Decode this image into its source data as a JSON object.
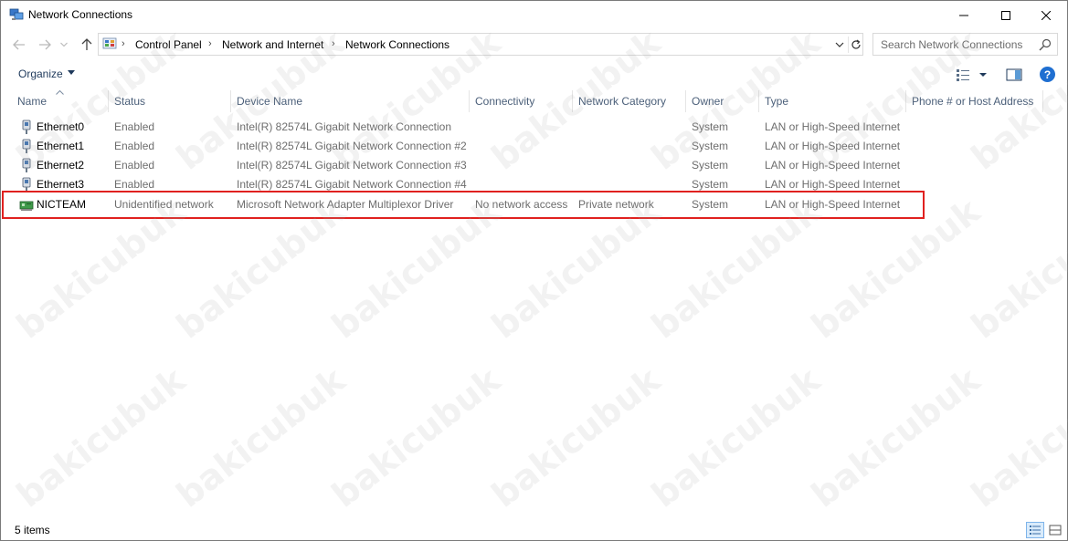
{
  "window": {
    "title": "Network Connections"
  },
  "address": {
    "crumbs": [
      "Control Panel",
      "Network and Internet",
      "Network Connections"
    ],
    "search_placeholder": "Search Network Connections"
  },
  "toolbar": {
    "organize_label": "Organize",
    "help_label": "?"
  },
  "columns": [
    "Name",
    "Status",
    "Device Name",
    "Connectivity",
    "Network Category",
    "Owner",
    "Type",
    "Phone # or Host Address"
  ],
  "rows": [
    {
      "name": "Ethernet0",
      "status": "Enabled",
      "device": "Intel(R) 82574L Gigabit Network Connection",
      "connectivity": "",
      "category": "",
      "owner": "System",
      "type": "LAN or High-Speed Internet",
      "phone": "",
      "icon": "ethernet-adapter-icon"
    },
    {
      "name": "Ethernet1",
      "status": "Enabled",
      "device": "Intel(R) 82574L Gigabit Network Connection #2",
      "connectivity": "",
      "category": "",
      "owner": "System",
      "type": "LAN or High-Speed Internet",
      "phone": "",
      "icon": "ethernet-adapter-icon"
    },
    {
      "name": "Ethernet2",
      "status": "Enabled",
      "device": "Intel(R) 82574L Gigabit Network Connection #3",
      "connectivity": "",
      "category": "",
      "owner": "System",
      "type": "LAN or High-Speed Internet",
      "phone": "",
      "icon": "ethernet-adapter-icon"
    },
    {
      "name": "Ethernet3",
      "status": "Enabled",
      "device": "Intel(R) 82574L Gigabit Network Connection #4",
      "connectivity": "",
      "category": "",
      "owner": "System",
      "type": "LAN or High-Speed Internet",
      "phone": "",
      "icon": "ethernet-adapter-icon"
    },
    {
      "name": "NICTEAM",
      "status": "Unidentified network",
      "device": "Microsoft Network Adapter Multiplexor Driver",
      "connectivity": "No network access",
      "category": "Private network",
      "owner": "System",
      "type": "LAN or High-Speed Internet",
      "phone": "",
      "icon": "network-adapter-green-icon"
    }
  ],
  "statusbar": {
    "items_count": "5 items"
  },
  "watermark": "bakicubuk",
  "colors": {
    "highlight_border": "#e0211f",
    "header_text": "#4c607a",
    "cell_text": "#6d6d6d",
    "help_blue": "#1f6fd1"
  }
}
